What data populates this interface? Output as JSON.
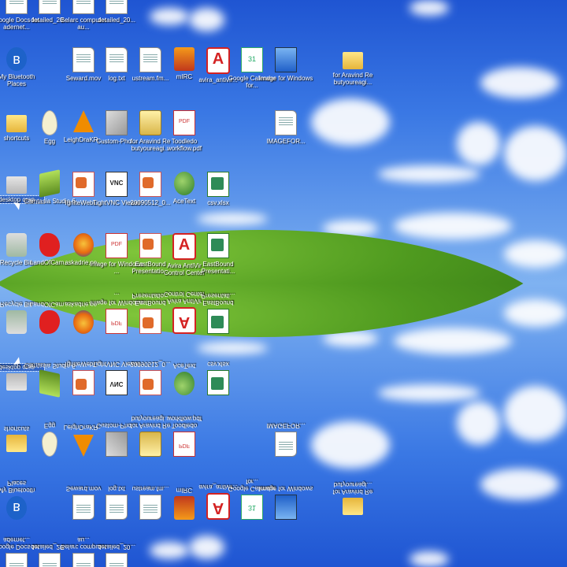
{
  "desktop": {
    "wallpaper": "Bliss",
    "accent": "#3165c5",
    "icons": [
      {
        "label": "Google Docs for adernet...",
        "icon": "doc-icon"
      },
      {
        "label": "detailed_20...",
        "icon": "doc-icon"
      },
      {
        "label": "Belarc computer au...",
        "icon": "doc-icon"
      },
      {
        "label": "detailed_20...",
        "icon": "doc-icon"
      },
      {
        "label": "My Bluetooth Places",
        "icon": "bluetooth-icon"
      },
      {
        "label": "Seward.mov",
        "icon": "movie-file-icon"
      },
      {
        "label": "log.txt",
        "icon": "text-file-icon"
      },
      {
        "label": "ustream.fm...",
        "icon": "doc-icon"
      },
      {
        "label": "mIRC",
        "icon": "mirc-icon"
      },
      {
        "label": "avira_antivir...",
        "icon": "avira-icon"
      },
      {
        "label": "Google Calendar for...",
        "icon": "calendar-icon"
      },
      {
        "label": "Image for Windows",
        "icon": "image-for-windows-icon"
      },
      {
        "label": "for Aravind Re butyoureagi...",
        "icon": "folder-icon"
      },
      {
        "label": "shortcuts",
        "icon": "folder-icon"
      },
      {
        "label": "Egg",
        "icon": "egg-icon"
      },
      {
        "label": "LeighDraKR...",
        "icon": "vlc-cone-icon"
      },
      {
        "label": "Custom-Pho...",
        "icon": "cube-icon"
      },
      {
        "label": "for Aravind Re butyoureagi...",
        "icon": "scroll-icon"
      },
      {
        "label": "Toodledo workflow.pdf",
        "icon": "pdf-icon"
      },
      {
        "label": "IMAGEFOR...",
        "icon": "image-file-icon"
      },
      {
        "label": "desktop crap",
        "icon": "desktop-crap-icon"
      },
      {
        "label": "Camtasia Studio 6",
        "icon": "camtasia-icon"
      },
      {
        "label": "IgniteWebL...",
        "icon": "word-doc-icon"
      },
      {
        "label": "TightVNC Viewer",
        "icon": "vnc-icon"
      },
      {
        "label": "20090512_0...",
        "icon": "word-doc-icon"
      },
      {
        "label": "AceText",
        "icon": "globe-icon"
      },
      {
        "label": "csv.xlsx",
        "icon": "excel-icon"
      },
      {
        "label": "Recycle Bin",
        "icon": "recycle-bin-icon"
      },
      {
        "label": "LandOfCam...",
        "icon": "splat-icon"
      },
      {
        "label": "askadrie.co...",
        "icon": "firefox-icon"
      },
      {
        "label": "Image for Windows ...",
        "icon": "pdf-icon"
      },
      {
        "label": "EastBound Presentatio...",
        "icon": "word-doc-icon"
      },
      {
        "label": "Avira AntiVir Control Center",
        "icon": "avira-icon"
      },
      {
        "label": "EastBound Presentati...",
        "icon": "excel-icon"
      }
    ]
  }
}
